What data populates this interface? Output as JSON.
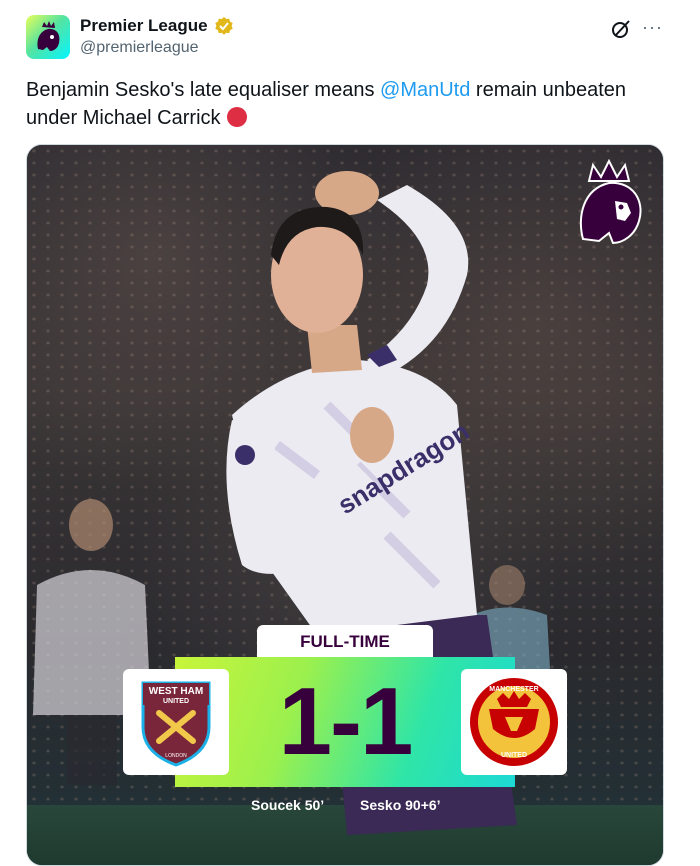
{
  "account": {
    "display_name": "Premier League",
    "handle": "@premierleague",
    "verified_badge": "verified-badge-icon"
  },
  "actions": {
    "grok": "grok-icon",
    "more": "···"
  },
  "tweet": {
    "text_before": "Benjamin Sesko's late equaliser means ",
    "mention": "@ManUtd",
    "text_after": " remain unbeaten under Michael Carrick",
    "emoji": "red-circle-emoji"
  },
  "media": {
    "status_tab": "FULL-TIME",
    "score": "1-1",
    "home_team": {
      "crest_text_top": "WEST HAM",
      "crest_text_mid": "UNITED",
      "crest_text_bottom": "LONDON",
      "scorer": "Soucek 50’"
    },
    "away_team": {
      "crest_text_top": "MANCHESTER",
      "crest_text_bottom": "UNITED",
      "scorer": "Sesko 90+6’"
    },
    "shirt_sponsor": "snapdragon",
    "colors": {
      "pl_purple": "#37003c",
      "gradient_start": "#c8f53a",
      "gradient_end": "#1cd9d4",
      "mention_blue": "#1d9bf0"
    }
  }
}
